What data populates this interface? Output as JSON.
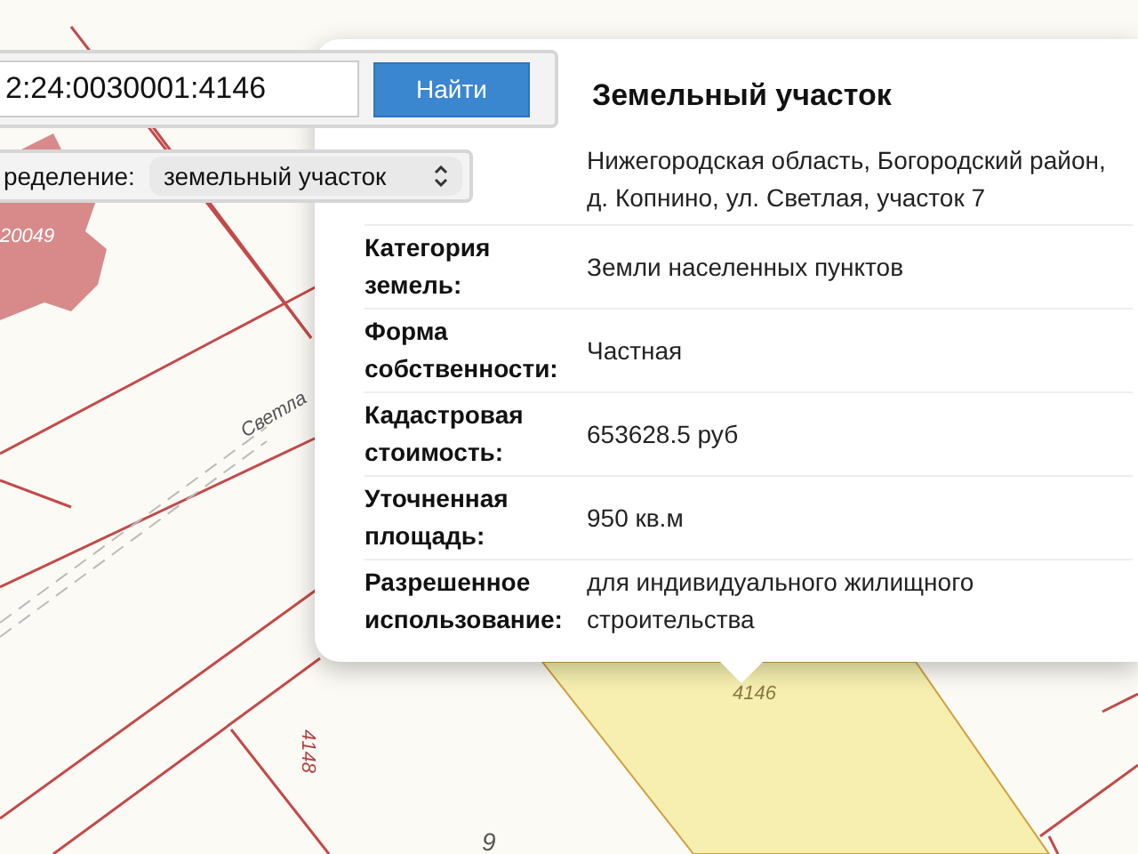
{
  "search": {
    "value": "2:24:0030001:4146",
    "button": "Найти"
  },
  "definition": {
    "label": "ределение:",
    "value": "земельный участок"
  },
  "map_labels": [
    {
      "text": "20049"
    },
    {
      "text": "Светла"
    },
    {
      "text": "4148"
    },
    {
      "text": "4146"
    },
    {
      "text": "9"
    }
  ],
  "popup": {
    "title": "Земельный участок",
    "address": "Нижегородская область, Богородский район, д. Копнино, ул. Светлая, участок 7",
    "rows": [
      {
        "label": "Категория земель:",
        "value": "Земли населенных пунктов"
      },
      {
        "label": "Форма собственности:",
        "value": "Частная"
      },
      {
        "label": "Кадастровая стоимость:",
        "value": "653628.5 руб"
      },
      {
        "label": "Уточненная площадь:",
        "value": "950 кв.м"
      },
      {
        "label": "Разрешенное использование:",
        "value": "для индивидуального жилищного строительства"
      }
    ]
  }
}
